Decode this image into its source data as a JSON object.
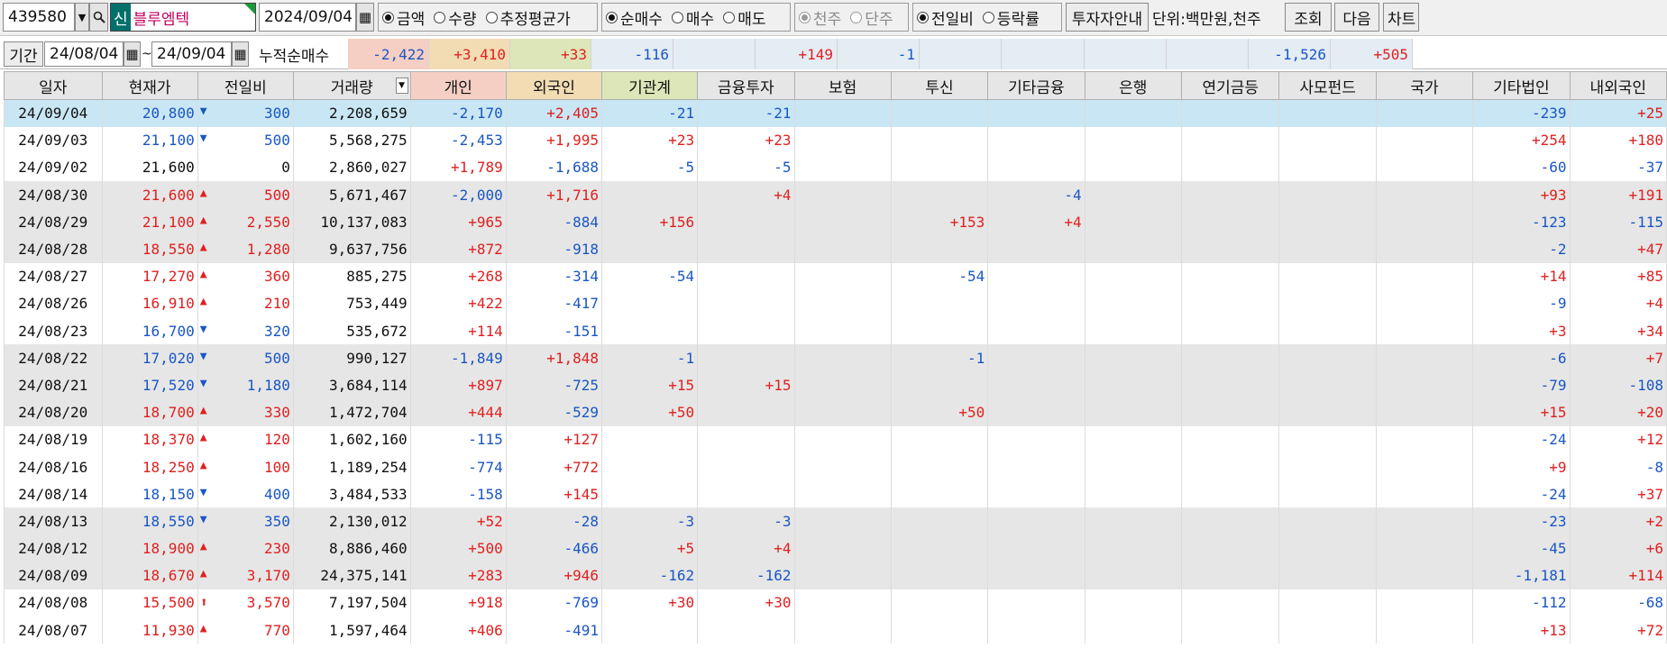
{
  "toolbar": {
    "code": "439580",
    "new_badge": "신",
    "stock_name": "블루엠텍",
    "date": "2024/09/04",
    "radio_group1": [
      {
        "label": "금액",
        "selected": true
      },
      {
        "label": "수량",
        "selected": false
      },
      {
        "label": "추정평균가",
        "selected": false
      }
    ],
    "radio_group2": [
      {
        "label": "순매수",
        "selected": true
      },
      {
        "label": "매수",
        "selected": false
      },
      {
        "label": "매도",
        "selected": false
      }
    ],
    "radio_group3": [
      {
        "label": "천주",
        "selected": true
      },
      {
        "label": "단주",
        "selected": false
      }
    ],
    "radio_group4": [
      {
        "label": "전일비",
        "selected": true
      },
      {
        "label": "등락률",
        "selected": false
      }
    ],
    "guide_btn": "투자자안내",
    "unit": "단위:백만원,천주",
    "query_btn": "조회",
    "next_btn": "다음",
    "chart_btn": "차트"
  },
  "period": {
    "label": "기간",
    "start": "24/08/04",
    "tilde": "~",
    "end": "24/09/04",
    "cumulative_label": "누적순매수"
  },
  "cumulative": [
    "-2,422",
    "+3,410",
    "+33",
    "-116",
    "",
    "+149",
    "-1",
    "",
    "",
    "",
    "",
    "-1,526",
    "+505"
  ],
  "headers": [
    "일자",
    "현재가",
    "전일비",
    "거래량",
    "개인",
    "외국인",
    "기관계",
    "금융투자",
    "보험",
    "투신",
    "기타금융",
    "은행",
    "연기금등",
    "사모펀드",
    "국가",
    "기타법인",
    "내외국인"
  ],
  "colors": {
    "up": "#e02020",
    "down": "#1a56c4",
    "selected_row": "#c9e6f4",
    "alt_row": "#e6e6e6"
  },
  "rows": [
    {
      "date": "24/09/04",
      "price": "20,800",
      "dir": "down",
      "chg": "300",
      "vol": "2,208,659",
      "v": [
        "-2,170",
        "+2,405",
        "-21",
        "-21",
        "",
        "",
        "",
        "",
        "",
        "",
        "",
        "-239",
        "+25"
      ]
    },
    {
      "date": "24/09/03",
      "price": "21,100",
      "dir": "down",
      "chg": "500",
      "vol": "5,568,275",
      "v": [
        "-2,453",
        "+1,995",
        "+23",
        "+23",
        "",
        "",
        "",
        "",
        "",
        "",
        "",
        "+254",
        "+180"
      ]
    },
    {
      "date": "24/09/02",
      "price": "21,600",
      "dir": "flat",
      "chg": "0",
      "vol": "2,860,027",
      "v": [
        "+1,789",
        "-1,688",
        "-5",
        "-5",
        "",
        "",
        "",
        "",
        "",
        "",
        "",
        "-60",
        "-37"
      ]
    },
    {
      "date": "24/08/30",
      "price": "21,600",
      "dir": "up",
      "chg": "500",
      "vol": "5,671,467",
      "v": [
        "-2,000",
        "+1,716",
        "",
        "+4",
        "",
        "",
        "-4",
        "",
        "",
        "",
        "",
        "+93",
        "+191"
      ]
    },
    {
      "date": "24/08/29",
      "price": "21,100",
      "dir": "up",
      "chg": "2,550",
      "vol": "10,137,083",
      "v": [
        "+965",
        "-884",
        "+156",
        "",
        "",
        "+153",
        "+4",
        "",
        "",
        "",
        "",
        "-123",
        "-115"
      ]
    },
    {
      "date": "24/08/28",
      "price": "18,550",
      "dir": "up",
      "chg": "1,280",
      "vol": "9,637,756",
      "v": [
        "+872",
        "-918",
        "",
        "",
        "",
        "",
        "",
        "",
        "",
        "",
        "",
        "-2",
        "+47"
      ]
    },
    {
      "date": "24/08/27",
      "price": "17,270",
      "dir": "up",
      "chg": "360",
      "vol": "885,275",
      "v": [
        "+268",
        "-314",
        "-54",
        "",
        "",
        "-54",
        "",
        "",
        "",
        "",
        "",
        "+14",
        "+85"
      ]
    },
    {
      "date": "24/08/26",
      "price": "16,910",
      "dir": "up",
      "chg": "210",
      "vol": "753,449",
      "v": [
        "+422",
        "-417",
        "",
        "",
        "",
        "",
        "",
        "",
        "",
        "",
        "",
        "-9",
        "+4"
      ]
    },
    {
      "date": "24/08/23",
      "price": "16,700",
      "dir": "down",
      "chg": "320",
      "vol": "535,672",
      "v": [
        "+114",
        "-151",
        "",
        "",
        "",
        "",
        "",
        "",
        "",
        "",
        "",
        "+3",
        "+34"
      ]
    },
    {
      "date": "24/08/22",
      "price": "17,020",
      "dir": "down",
      "chg": "500",
      "vol": "990,127",
      "v": [
        "-1,849",
        "+1,848",
        "-1",
        "",
        "",
        "-1",
        "",
        "",
        "",
        "",
        "",
        "-6",
        "+7"
      ]
    },
    {
      "date": "24/08/21",
      "price": "17,520",
      "dir": "down",
      "chg": "1,180",
      "vol": "3,684,114",
      "v": [
        "+897",
        "-725",
        "+15",
        "+15",
        "",
        "",
        "",
        "",
        "",
        "",
        "",
        "-79",
        "-108"
      ]
    },
    {
      "date": "24/08/20",
      "price": "18,700",
      "dir": "up",
      "chg": "330",
      "vol": "1,472,704",
      "v": [
        "+444",
        "-529",
        "+50",
        "",
        "",
        "+50",
        "",
        "",
        "",
        "",
        "",
        "+15",
        "+20"
      ]
    },
    {
      "date": "24/08/19",
      "price": "18,370",
      "dir": "up",
      "chg": "120",
      "vol": "1,602,160",
      "v": [
        "-115",
        "+127",
        "",
        "",
        "",
        "",
        "",
        "",
        "",
        "",
        "",
        "-24",
        "+12"
      ]
    },
    {
      "date": "24/08/16",
      "price": "18,250",
      "dir": "up",
      "chg": "100",
      "vol": "1,189,254",
      "v": [
        "-774",
        "+772",
        "",
        "",
        "",
        "",
        "",
        "",
        "",
        "",
        "",
        "+9",
        "-8"
      ]
    },
    {
      "date": "24/08/14",
      "price": "18,150",
      "dir": "down",
      "chg": "400",
      "vol": "3,484,533",
      "v": [
        "-158",
        "+145",
        "",
        "",
        "",
        "",
        "",
        "",
        "",
        "",
        "",
        "-24",
        "+37"
      ]
    },
    {
      "date": "24/08/13",
      "price": "18,550",
      "dir": "down",
      "chg": "350",
      "vol": "2,130,012",
      "v": [
        "+52",
        "-28",
        "-3",
        "-3",
        "",
        "",
        "",
        "",
        "",
        "",
        "",
        "-23",
        "+2"
      ]
    },
    {
      "date": "24/08/12",
      "price": "18,900",
      "dir": "up",
      "chg": "230",
      "vol": "8,886,460",
      "v": [
        "+500",
        "-466",
        "+5",
        "+4",
        "",
        "",
        "",
        "",
        "",
        "",
        "",
        "-45",
        "+6"
      ]
    },
    {
      "date": "24/08/09",
      "price": "18,670",
      "dir": "up",
      "chg": "3,170",
      "vol": "24,375,141",
      "v": [
        "+283",
        "+946",
        "-162",
        "-162",
        "",
        "",
        "",
        "",
        "",
        "",
        "",
        "-1,181",
        "+114"
      ]
    },
    {
      "date": "24/08/08",
      "price": "15,500",
      "dir": "limit",
      "chg": "3,570",
      "vol": "7,197,504",
      "v": [
        "+918",
        "-769",
        "+30",
        "+30",
        "",
        "",
        "",
        "",
        "",
        "",
        "",
        "-112",
        "-68"
      ]
    },
    {
      "date": "24/08/07",
      "price": "11,930",
      "dir": "up",
      "chg": "770",
      "vol": "1,597,464",
      "v": [
        "+406",
        "-491",
        "",
        "",
        "",
        "",
        "",
        "",
        "",
        "",
        "",
        "+13",
        "+72"
      ]
    }
  ]
}
